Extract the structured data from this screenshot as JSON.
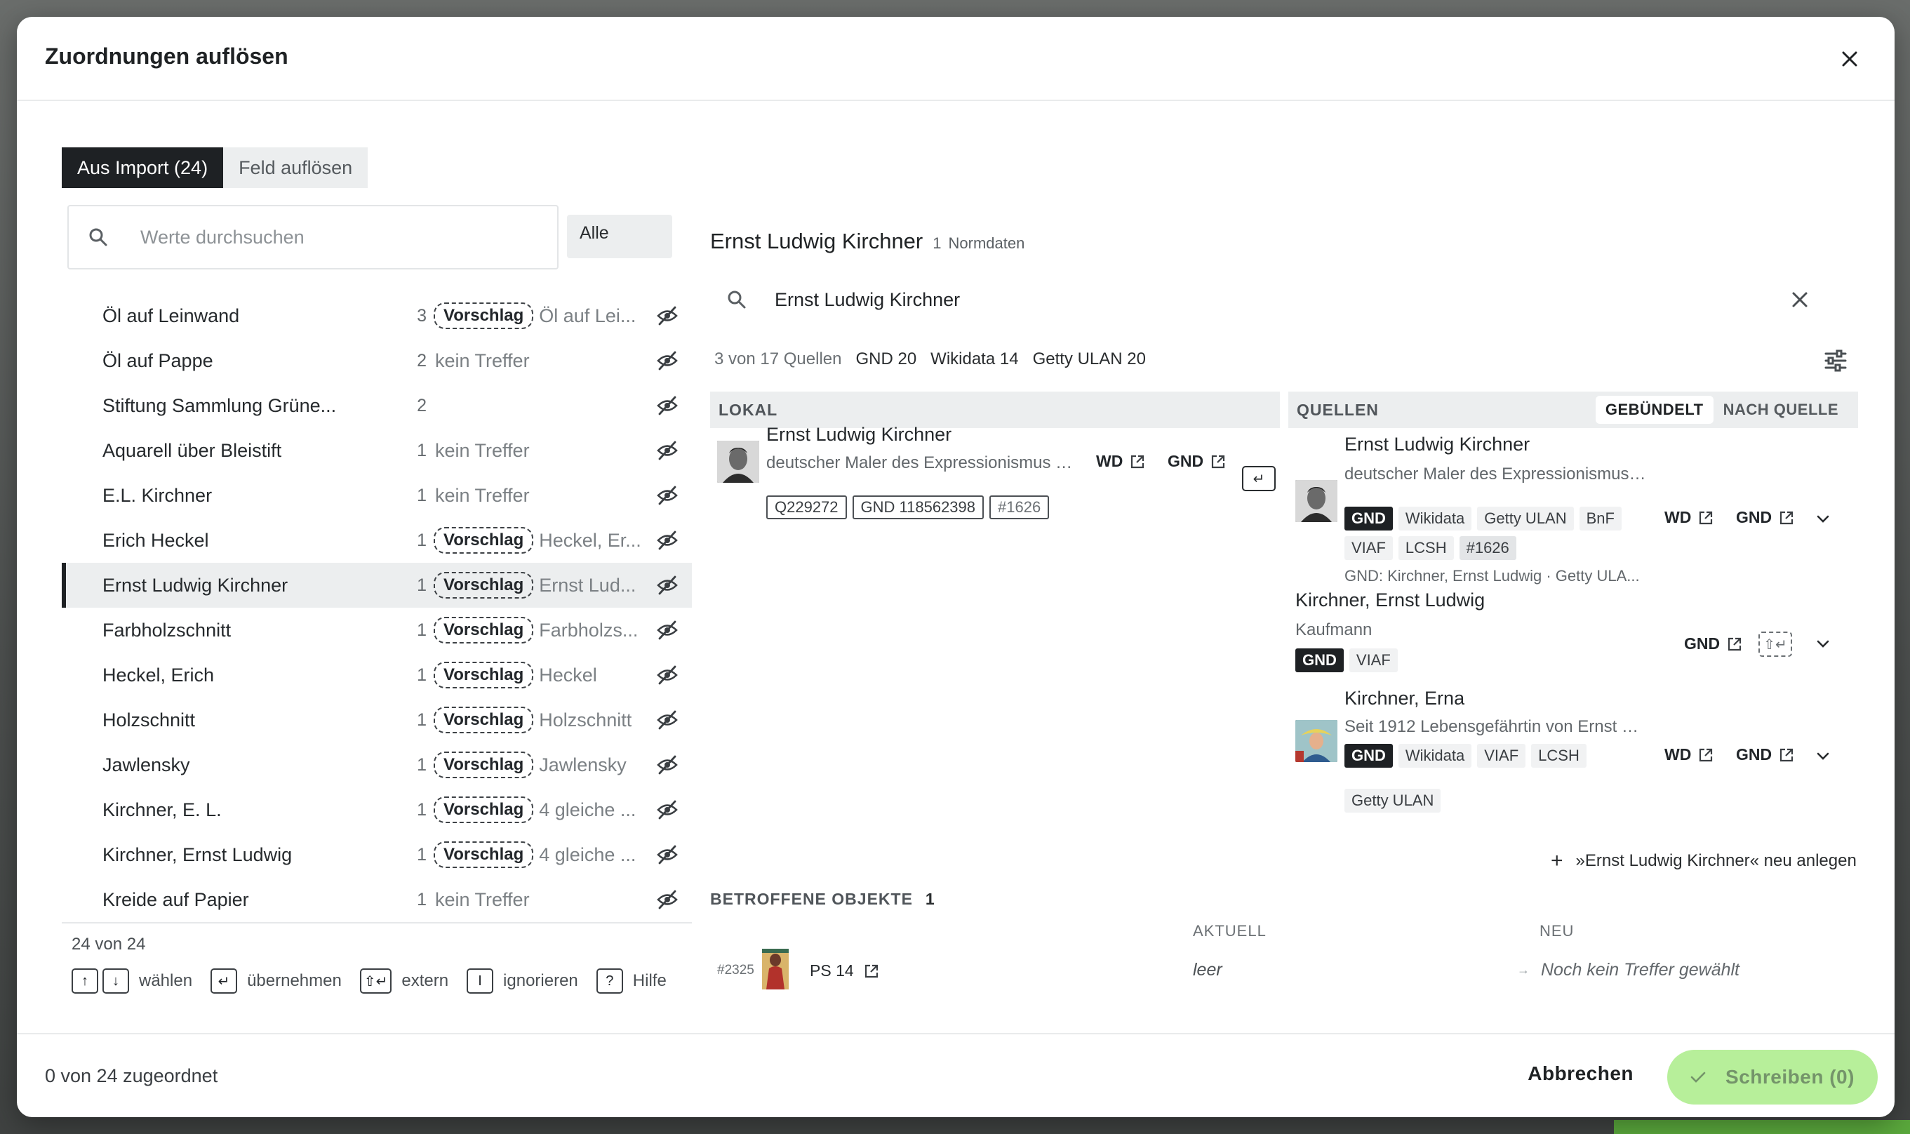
{
  "modal": {
    "title": "Zuordnungen auflösen"
  },
  "tabs": [
    {
      "label": "Aus Import (24)",
      "active": true
    },
    {
      "label": "Feld auflösen",
      "active": false
    }
  ],
  "search": {
    "placeholder": "Werte durchsuchen",
    "filter": "Alle"
  },
  "values": [
    {
      "name": "Öl auf Leinwand",
      "count": "3",
      "pill": "Vorschlag",
      "hint": "Öl auf Lei...",
      "status": "suggestion"
    },
    {
      "name": "Öl auf Pappe",
      "count": "2",
      "pill": "",
      "hint": "kein Treffer",
      "status": "none"
    },
    {
      "name": "Stiftung Sammlung Grüne...",
      "count": "2",
      "pill": "",
      "hint": "",
      "status": "empty"
    },
    {
      "name": "Aquarell über Bleistift",
      "count": "1",
      "pill": "",
      "hint": "kein Treffer",
      "status": "none"
    },
    {
      "name": "E.L. Kirchner",
      "count": "1",
      "pill": "",
      "hint": "kein Treffer",
      "status": "none"
    },
    {
      "name": "Erich Heckel",
      "count": "1",
      "pill": "Vorschlag",
      "hint": "Heckel, Er...",
      "status": "suggestion"
    },
    {
      "name": "Ernst Ludwig Kirchner",
      "count": "1",
      "pill": "Vorschlag",
      "hint": "Ernst Lud...",
      "status": "suggestion",
      "selected": true
    },
    {
      "name": "Farbholzschnitt",
      "count": "1",
      "pill": "Vorschlag",
      "hint": "Farbholzs...",
      "status": "suggestion"
    },
    {
      "name": "Heckel, Erich",
      "count": "1",
      "pill": "Vorschlag",
      "hint": "Heckel",
      "status": "suggestion"
    },
    {
      "name": "Holzschnitt",
      "count": "1",
      "pill": "Vorschlag",
      "hint": "Holzschnitt",
      "status": "suggestion"
    },
    {
      "name": "Jawlensky",
      "count": "1",
      "pill": "Vorschlag",
      "hint": "Jawlensky",
      "status": "suggestion"
    },
    {
      "name": "Kirchner, E. L.",
      "count": "1",
      "pill": "Vorschlag",
      "hint": "4 gleiche ...",
      "status": "suggestion"
    },
    {
      "name": "Kirchner, Ernst Ludwig",
      "count": "1",
      "pill": "Vorschlag",
      "hint": "4 gleiche ...",
      "status": "suggestion"
    },
    {
      "name": "Kreide auf Papier",
      "count": "1",
      "pill": "",
      "hint": "kein Treffer",
      "status": "none"
    }
  ],
  "list_footer": {
    "count": "24 von 24",
    "shortcuts": [
      {
        "keys": [
          "↑",
          "↓"
        ],
        "label": "wählen"
      },
      {
        "keys": [
          "↵"
        ],
        "label": "übernehmen"
      },
      {
        "keys": [
          "⇧↵"
        ],
        "label": "extern"
      },
      {
        "keys": [
          "I"
        ],
        "label": "ignorieren"
      },
      {
        "keys": [
          "?"
        ],
        "label": "Hilfe"
      }
    ]
  },
  "entity": {
    "title": "Ernst Ludwig Kirchner",
    "count": "1",
    "count_label": "Normdaten",
    "search_value": "Ernst Ludwig Kirchner",
    "sources_summary": "3 von 17 Quellen",
    "sources": [
      "GND 20",
      "Wikidata 14",
      "Getty ULAN 20"
    ]
  },
  "lokal": {
    "header": "LOKAL",
    "entry": {
      "name": "Ernst Ludwig Kirchner",
      "desc": "deutscher Maler des Expressionismus (1...",
      "links": [
        "WD",
        "GND"
      ],
      "enter_key": "↵",
      "tags": [
        "Q229272",
        "GND 118562398",
        "#1626"
      ]
    }
  },
  "quellen": {
    "header": "QUELLEN",
    "toggle": [
      "GEBÜNDELT",
      "NACH QUELLE"
    ],
    "entries": [
      {
        "name": "Ernst Ludwig Kirchner",
        "desc": "deutscher Maler des Expressionismus (...",
        "tags_row1": [
          "GND",
          "Wikidata",
          "Getty ULAN",
          "BnF"
        ],
        "tags_row2": [
          "VIAF",
          "LCSH",
          "#1626"
        ],
        "note": "GND: Kirchner, Ernst Ludwig · Getty ULA...",
        "links": [
          "WD",
          "GND"
        ]
      },
      {
        "name": "Kirchner, Ernst Ludwig",
        "desc": "Kaufmann",
        "tags_row1": [
          "GND",
          "VIAF"
        ],
        "links": [
          "GND"
        ],
        "enter_key": "⇧↵"
      },
      {
        "name": "Kirchner, Erna",
        "desc": "Seit 1912 Lebensgefährtin von Ernst Lu...",
        "tags_row1": [
          "GND",
          "Wikidata",
          "VIAF",
          "LCSH"
        ],
        "tags_row2": [
          "Getty ULAN"
        ],
        "links": [
          "WD",
          "GND"
        ]
      }
    ],
    "create_new": "»Ernst Ludwig Kirchner« neu anlegen"
  },
  "affected": {
    "header": "BETROFFENE OBJEKTE",
    "count": "1",
    "col_current": "AKTUELL",
    "col_new": "NEU",
    "rows": [
      {
        "id": "#2325",
        "name": "PS 14",
        "current": "leer",
        "new": "Noch kein Treffer gewählt"
      }
    ]
  },
  "footer": {
    "assigned": "0 von 24 zugeordnet",
    "cancel": "Abbrechen",
    "write": "Schreiben (0)"
  },
  "colors": {
    "accent_dark": "#1e2124",
    "primary_disabled": "#b7ef9a"
  }
}
